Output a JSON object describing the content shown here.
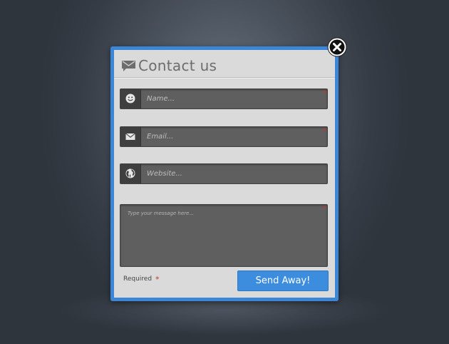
{
  "colors": {
    "accent": "#3d8ddf",
    "frame": "#3b86d6",
    "panel": "#dadada",
    "field": "#5f5f5f",
    "required_star": "#c0392b"
  },
  "header": {
    "icon": "envelope-icon",
    "title": "Contact us"
  },
  "close_button": {
    "icon": "close-icon"
  },
  "form": {
    "name": {
      "icon": "smiley-icon",
      "placeholder": "Name...",
      "value": "",
      "required_mark": "*"
    },
    "email": {
      "icon": "envelope-icon",
      "placeholder": "Email...",
      "value": "",
      "required_mark": "*"
    },
    "website": {
      "icon": "globe-icon",
      "placeholder": "Website...",
      "value": ""
    },
    "message": {
      "placeholder": "Type your message here...",
      "value": "",
      "required_mark": "*"
    }
  },
  "footer": {
    "required_label": "Required",
    "required_mark": "*",
    "submit_label": "Send Away!"
  }
}
